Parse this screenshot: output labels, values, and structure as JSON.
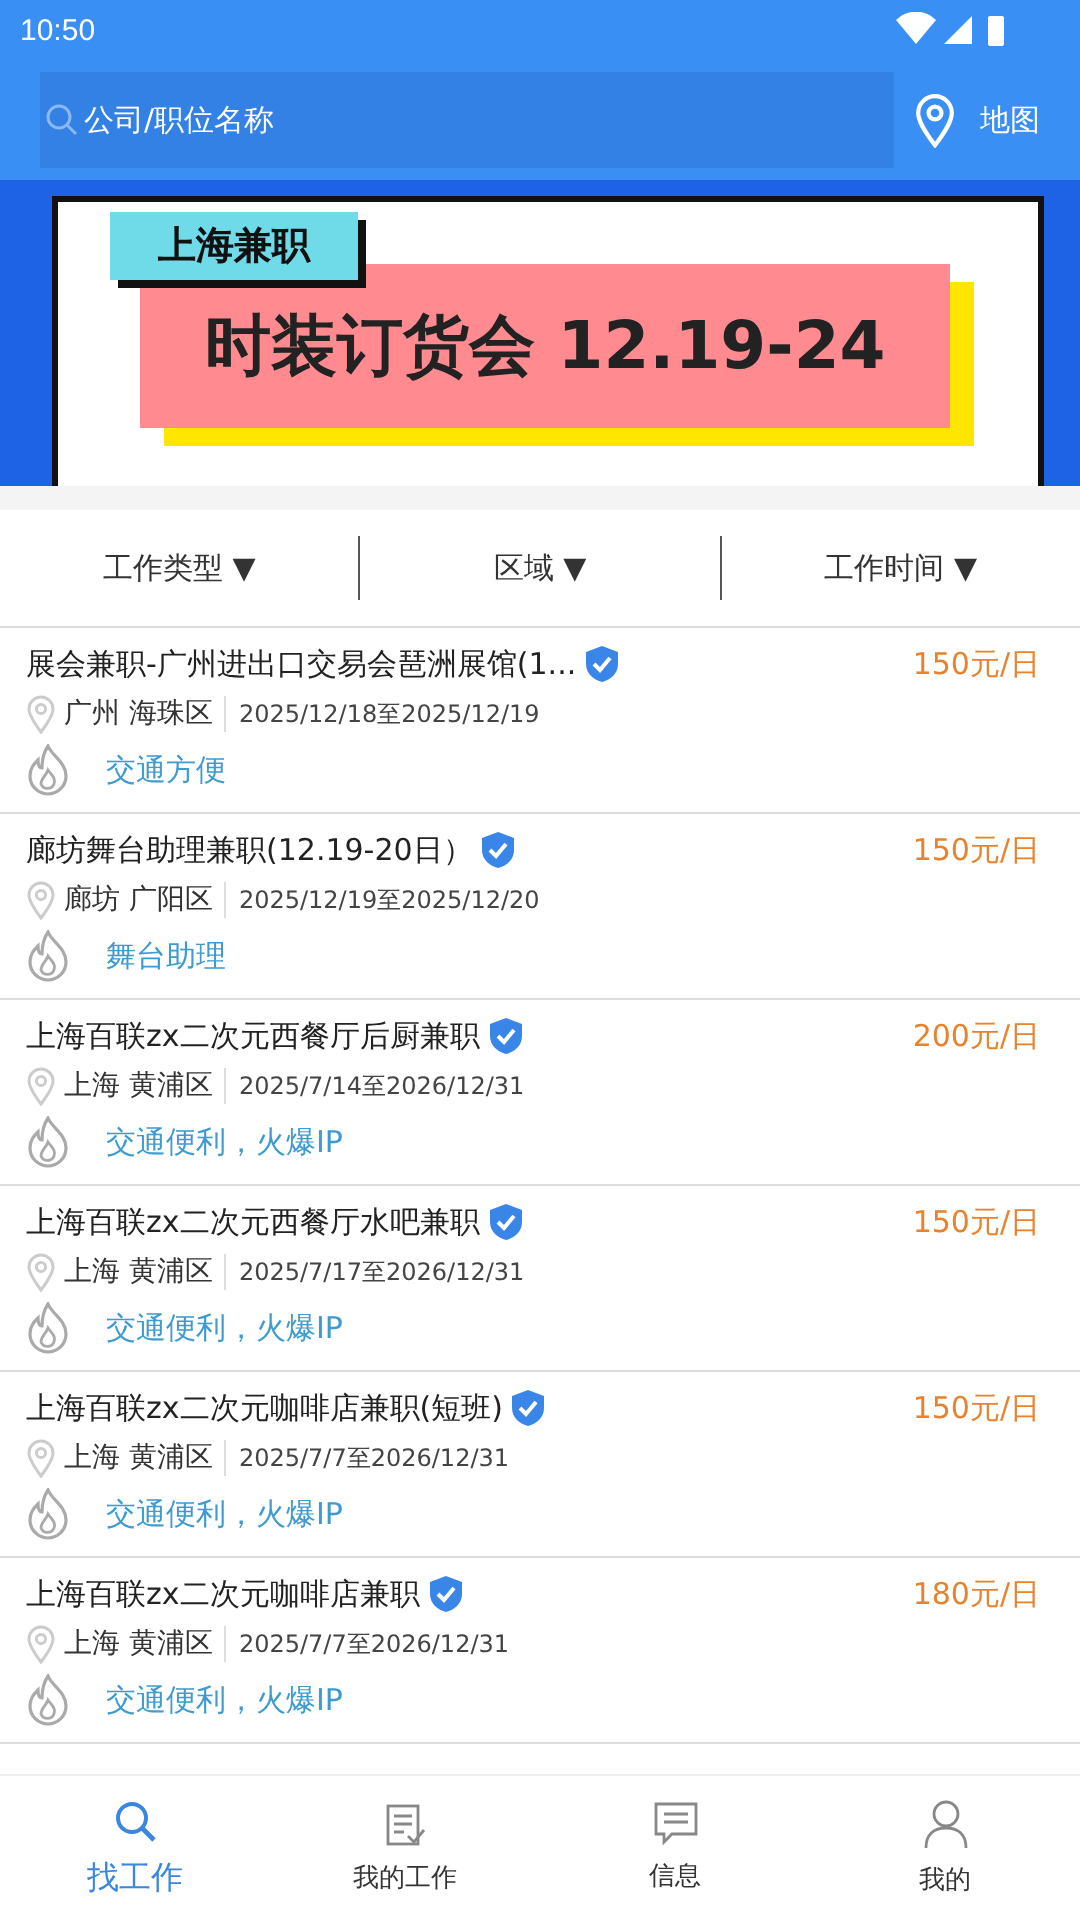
{
  "status_bar": {
    "time": "10:50"
  },
  "search": {
    "placeholder": "公司/职位名称"
  },
  "map_button": {
    "label": "地图"
  },
  "banner": {
    "tag": "上海兼职",
    "headline": "时装订货会 12.19-24"
  },
  "filters": [
    {
      "label": "工作类型",
      "arrow": "▼"
    },
    {
      "label": "区域",
      "arrow": "▼"
    },
    {
      "label": "工作时间",
      "arrow": "▼"
    }
  ],
  "jobs": [
    {
      "title": "展会兼职-广州进出口交易会琶洲展馆(1...",
      "verified": true,
      "pay": "150元/日",
      "location": "广州 海珠区",
      "dates": "2025/12/18至2025/12/19",
      "tags": "交通方便"
    },
    {
      "title": "廊坊舞台助理兼职(12.19-20日）",
      "verified": true,
      "pay": "150元/日",
      "location": "廊坊 广阳区",
      "dates": "2025/12/19至2025/12/20",
      "tags": "舞台助理"
    },
    {
      "title": "上海百联zx二次元西餐厅后厨兼职",
      "verified": true,
      "pay": "200元/日",
      "location": "上海 黄浦区",
      "dates": "2025/7/14至2026/12/31",
      "tags": "交通便利，火爆IP"
    },
    {
      "title": "上海百联zx二次元西餐厅水吧兼职",
      "verified": true,
      "pay": "150元/日",
      "location": "上海 黄浦区",
      "dates": "2025/7/17至2026/12/31",
      "tags": "交通便利，火爆IP"
    },
    {
      "title": "上海百联zx二次元咖啡店兼职(短班)",
      "verified": true,
      "pay": "150元/日",
      "location": "上海 黄浦区",
      "dates": "2025/7/7至2026/12/31",
      "tags": "交通便利，火爆IP"
    },
    {
      "title": "上海百联zx二次元咖啡店兼职",
      "verified": true,
      "pay": "180元/日",
      "location": "上海 黄浦区",
      "dates": "2025/7/7至2026/12/31",
      "tags": "交通便利，火爆IP"
    }
  ],
  "tabs": [
    {
      "label": "找工作",
      "kind": "search",
      "selected": true
    },
    {
      "label": "我的工作",
      "kind": "clipboard",
      "selected": false
    },
    {
      "label": "信息",
      "kind": "message",
      "selected": false
    },
    {
      "label": "我的",
      "kind": "person",
      "selected": false
    }
  ]
}
